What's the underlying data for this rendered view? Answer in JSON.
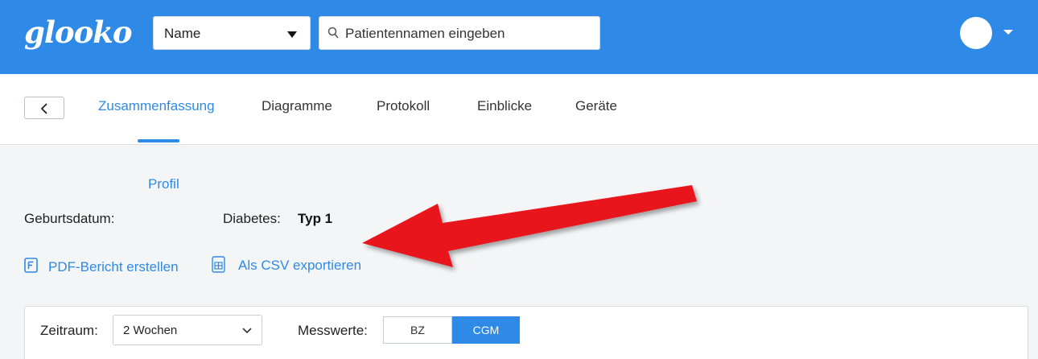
{
  "header": {
    "logo": "glooko",
    "search_type": {
      "selected": "Name"
    },
    "search": {
      "placeholder": "Patientennamen eingeben"
    }
  },
  "tabs": [
    {
      "label": "Zusammenfassung",
      "active": true
    },
    {
      "label": "Diagramme",
      "active": false
    },
    {
      "label": "Protokoll",
      "active": false
    },
    {
      "label": "Einblicke",
      "active": false
    },
    {
      "label": "Geräte",
      "active": false
    }
  ],
  "profile": {
    "link": "Profil",
    "birthdate_label": "Geburtsdatum:",
    "diabetes_label": "Diabetes:",
    "diabetes_value": "Typ 1"
  },
  "actions": {
    "pdf": "PDF-Bericht erstellen",
    "csv": "Als CSV exportieren"
  },
  "filters": {
    "period_label": "Zeitraum:",
    "period_value": "2 Wochen",
    "readings_label": "Messwerte:",
    "readings_options": [
      "BZ",
      "CGM"
    ],
    "readings_selected": "CGM"
  },
  "colors": {
    "brand_blue": "#2e8ae6",
    "annotation_red": "#e8141b"
  }
}
